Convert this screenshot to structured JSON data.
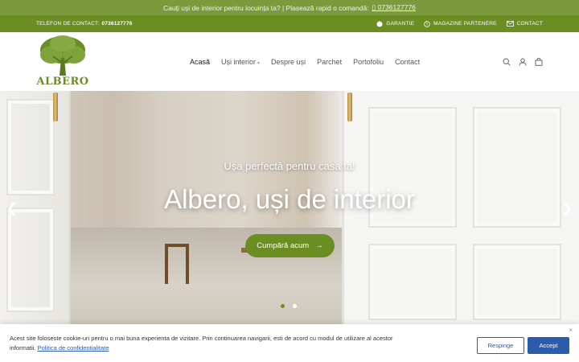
{
  "announcement": {
    "text": "Cauți uși de interior pentru locuința ta? | Plasează rapid o comandă:",
    "phone_icon": "phone-icon",
    "phone": "0736127776"
  },
  "topbar": {
    "phone_label": "TELEFON DE CONTACT:",
    "phone": "0736127776",
    "links": [
      {
        "label": "GARANTIE",
        "icon": "globe-icon"
      },
      {
        "label": "MAGAZINE PARTENERE",
        "icon": "info-icon"
      },
      {
        "label": "CONTACT",
        "icon": "mail-icon"
      }
    ]
  },
  "logo": {
    "text": "ALBERO"
  },
  "nav": {
    "items": [
      "Acasă",
      "Uși interior",
      "Despre uși",
      "Parchet",
      "Portofoliu",
      "Contact"
    ]
  },
  "hero": {
    "subtitle": "Ușa perfectă pentru casa ta!",
    "title": "Albero, uși de interior",
    "cta": "Cumpără acum",
    "slides": 2,
    "active_slide": 1
  },
  "cookie": {
    "text": "Acest site foloseste cookie-uri pentru o mai buna experienta de vizitare. Prin continuarea navigarii, esti de acord cu modul de utilizare al acestor informatii.",
    "link": "Politica de confidentialitate",
    "reject": "Respinge",
    "accept": "Accept",
    "close": "×"
  },
  "colors": {
    "brand_green": "#6b8e23",
    "announce_green": "#7a9a3c",
    "cookie_blue": "#2b5cab"
  }
}
